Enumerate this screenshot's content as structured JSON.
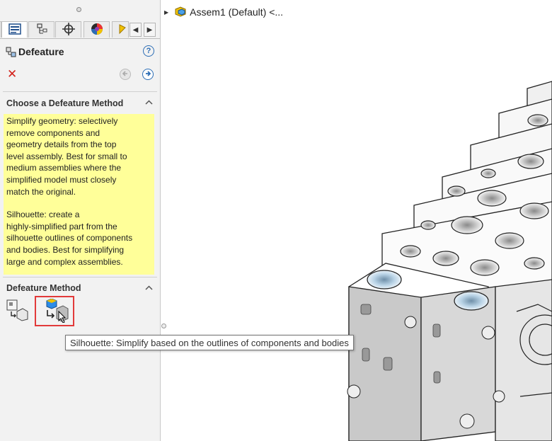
{
  "tree": {
    "assembly_label": "Assem1 (Default) <..."
  },
  "panel": {
    "title": "Defeature",
    "section1_title": "Choose a Defeature Method",
    "description_simplify": "Simplify geometry: selectively\nremove components and\ngeometry details from the top\nlevel assembly. Best for small to\nmedium assemblies where the\nsimplified model must closely\nmatch the original.",
    "description_silhouette": "Silhouette: create a\nhighly-simplified part from the\nsilhouette outlines of components\nand bodies. Best for simplifying\nlarge and complex assemblies.",
    "section2_title": "Defeature Method"
  },
  "tooltip": "Silhouette: Simplify based on the outlines of components and bodies",
  "icons": {
    "tabs": [
      "feature-manager-icon",
      "property-manager-icon",
      "configuration-manager-icon",
      "appearance-icon",
      "display-manager-icon"
    ],
    "help": "help-icon",
    "close": "close-icon",
    "back": "back-arrow-icon",
    "next": "next-arrow-icon",
    "collapse": "chevron-up-icon",
    "simplify": "simplify-geometry-icon",
    "silhouette": "silhouette-icon",
    "assembly": "assembly-icon"
  },
  "colors": {
    "description_bg": "#ffff99",
    "highlight_border": "#e23a3a",
    "close_red": "#d3221b",
    "accent_blue": "#2c6db5"
  }
}
